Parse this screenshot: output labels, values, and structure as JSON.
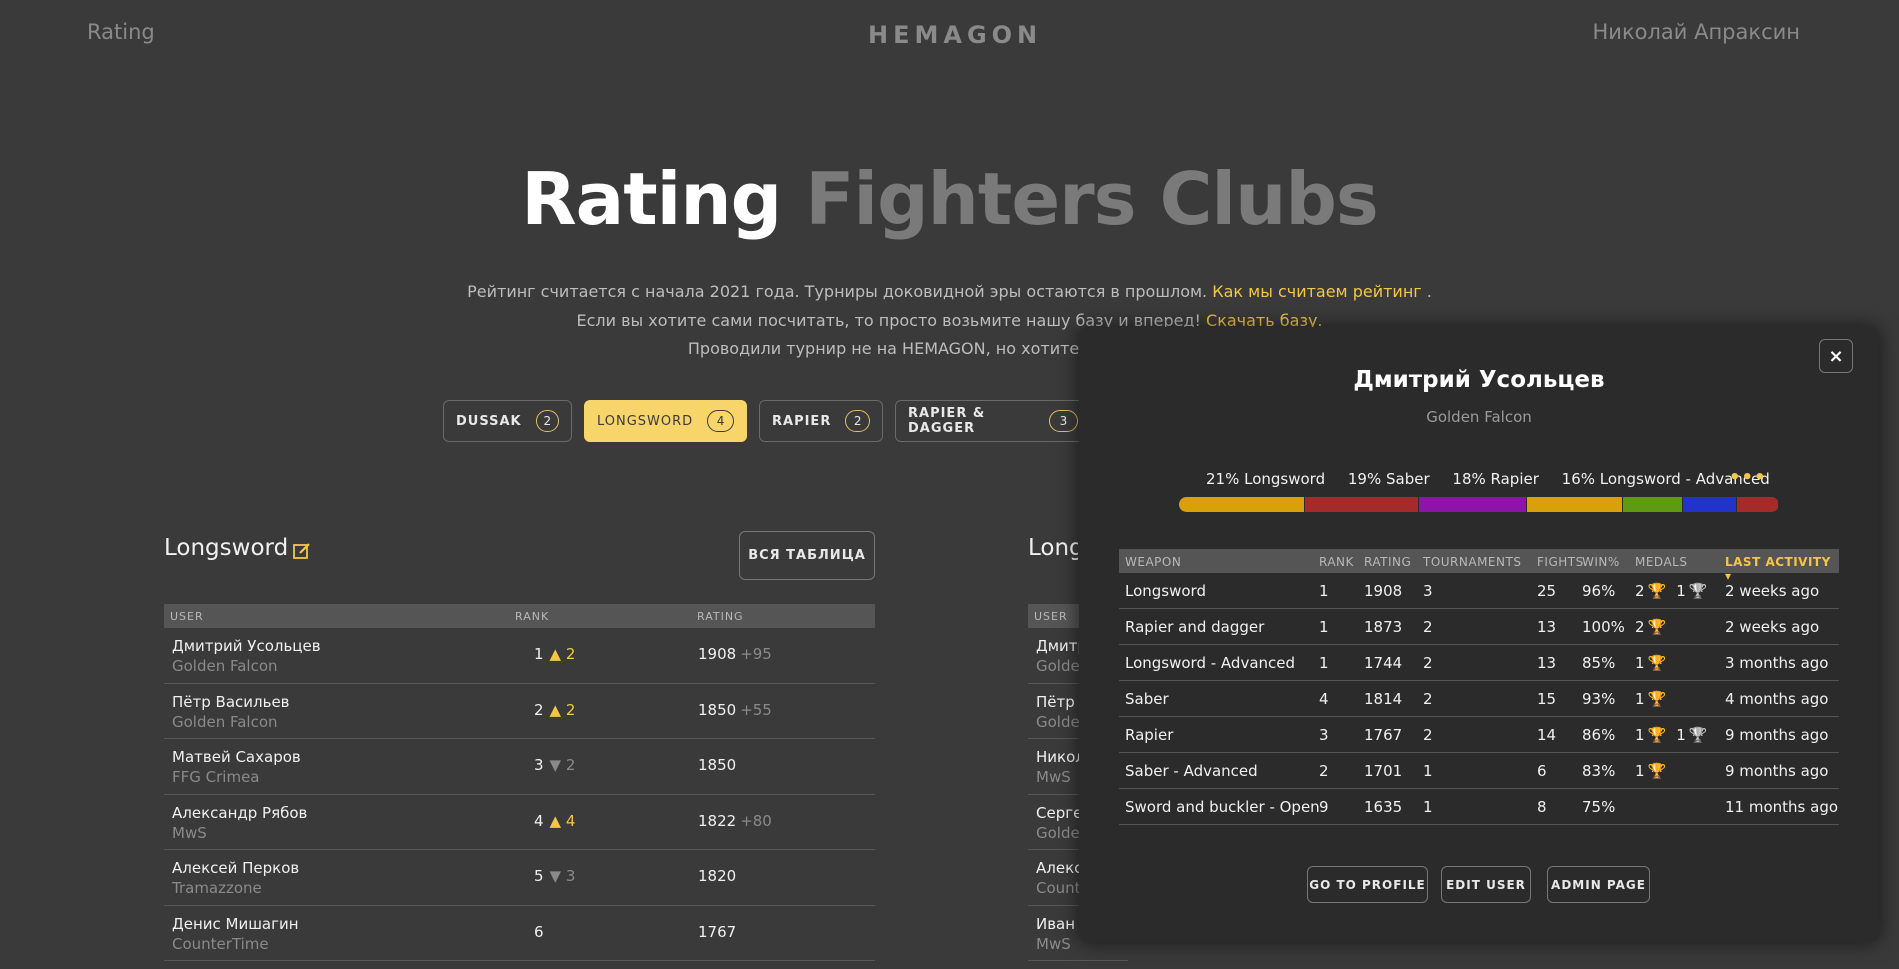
{
  "nav": {
    "rating": "Rating",
    "brand": "HEMAGON",
    "user": "Николай Апраксин"
  },
  "hero": {
    "title_white": "Rating",
    "title_gray": "Fighters Clubs"
  },
  "intro": {
    "line1": "Рейтинг считается с начала 2021 года. Турниры доковидной эры остаются в прошлом.",
    "line1_link": "Как мы считаем рейтинг",
    "line1_end": ".",
    "line2": "Если вы хотите сами посчитать, то просто возьмите нашу базу и вперед!",
    "line2_link": "Скачать базу.",
    "line3": "Проводили турнир не на HEMAGON, но хотите добавить его в"
  },
  "tabs": [
    {
      "label": "DUSSAK",
      "count": "2",
      "active": false
    },
    {
      "label": "LONGSWORD",
      "count": "4",
      "active": true
    },
    {
      "label": "RAPIER",
      "count": "2",
      "active": false
    },
    {
      "label": "RAPIER & DAGGER",
      "count": "3",
      "active": false
    }
  ],
  "left_table": {
    "title": "Longsword",
    "all_button": "ВСЯ ТАБЛИЦА",
    "headers": {
      "user": "USER",
      "rank": "RANK",
      "rating": "RATING"
    },
    "rows": [
      {
        "name": "Дмитрий Усольцев",
        "club": "Golden Falcon",
        "rank": "1",
        "arrow": "▲",
        "dir": "up",
        "change": "2",
        "rating": "1908",
        "delta": "+95"
      },
      {
        "name": "Пётр Васильев",
        "club": "Golden Falcon",
        "rank": "2",
        "arrow": "▲",
        "dir": "up",
        "change": "2",
        "rating": "1850",
        "delta": "+55"
      },
      {
        "name": "Матвей Сахаров",
        "club": "FFG Crimea",
        "rank": "3",
        "arrow": "▼",
        "dir": "dn",
        "change": "2",
        "rating": "1850",
        "delta": ""
      },
      {
        "name": "Александр Рябов",
        "club": "MwS",
        "rank": "4",
        "arrow": "▲",
        "dir": "up",
        "change": "4",
        "rating": "1822",
        "delta": "+80"
      },
      {
        "name": "Алексей Перков",
        "club": "Tramazzone",
        "rank": "5",
        "arrow": "▼",
        "dir": "dn",
        "change": "3",
        "rating": "1820",
        "delta": ""
      },
      {
        "name": "Денис Мишагин",
        "club": "CounterTime",
        "rank": "6",
        "arrow": "",
        "dir": "",
        "change": "",
        "rating": "1767",
        "delta": ""
      }
    ]
  },
  "right_table": {
    "title": "Longs",
    "headers": {
      "user": "USER"
    },
    "rows": [
      {
        "name": "Дмитр",
        "club": "Golden"
      },
      {
        "name": "Пётр В",
        "club": "Golden"
      },
      {
        "name": "Никол",
        "club": "MwS"
      },
      {
        "name": "Сергей",
        "club": "Golden"
      },
      {
        "name": "Алекса",
        "club": "Count"
      },
      {
        "name": "Иван I",
        "club": "MwS"
      }
    ]
  },
  "modal": {
    "close": "×",
    "name": "Дмитрий Усольцев",
    "club": "Golden Falcon",
    "distribution_labels": [
      "21% Longsword",
      "19% Saber",
      "18% Rapier",
      "16% Longsword - Advanced"
    ],
    "more": "•••",
    "distribution": [
      {
        "weapon": "Longsword",
        "share": 21,
        "color": "#d9a00a"
      },
      {
        "weapon": "Saber",
        "share": 19,
        "color": "#a52a2a"
      },
      {
        "weapon": "Rapier",
        "share": 18,
        "color": "#8f13a8"
      },
      {
        "weapon": "Longsword - Advanced",
        "share": 16,
        "color": "#d9a00a"
      },
      {
        "weapon": "Rapier and dagger",
        "share": 10,
        "color": "#5e9a12"
      },
      {
        "weapon": "Saber - Advanced",
        "share": 9,
        "color": "#2233cc"
      },
      {
        "weapon": "Sword and buckler - Open",
        "share": 7,
        "color": "#a52a2a"
      }
    ],
    "headers": {
      "weapon": "WEAPON",
      "rank": "RANK",
      "rating": "RATING",
      "tournaments": "TOURNAMENTS",
      "fights": "FIGHTS",
      "win": "WIN%",
      "medals": "MEDALS",
      "last": "LAST ACTIVITY"
    },
    "rows": [
      {
        "weapon": "Longsword",
        "rank": "1",
        "rating": "1908",
        "tournaments": "3",
        "fights": "25",
        "win": "96%",
        "gold": "2",
        "silver": "1",
        "last": "2 weeks ago"
      },
      {
        "weapon": "Rapier and dagger",
        "rank": "1",
        "rating": "1873",
        "tournaments": "2",
        "fights": "13",
        "win": "100%",
        "gold": "2",
        "silver": "",
        "last": "2 weeks ago"
      },
      {
        "weapon": "Longsword - Advanced",
        "rank": "1",
        "rating": "1744",
        "tournaments": "2",
        "fights": "13",
        "win": "85%",
        "gold": "1",
        "silver": "",
        "last": "3 months ago"
      },
      {
        "weapon": "Saber",
        "rank": "4",
        "rating": "1814",
        "tournaments": "2",
        "fights": "15",
        "win": "93%",
        "gold": "1",
        "silver": "",
        "last": "4 months ago"
      },
      {
        "weapon": "Rapier",
        "rank": "3",
        "rating": "1767",
        "tournaments": "2",
        "fights": "14",
        "win": "86%",
        "gold": "1",
        "silver": "1",
        "last": "9 months ago"
      },
      {
        "weapon": "Saber - Advanced",
        "rank": "2",
        "rating": "1701",
        "tournaments": "1",
        "fights": "6",
        "win": "83%",
        "gold": "1",
        "silver": "",
        "last": "9 months ago"
      },
      {
        "weapon": "Sword and buckler - Open",
        "rank": "9",
        "rating": "1635",
        "tournaments": "1",
        "fights": "8",
        "win": "75%",
        "gold": "",
        "silver": "",
        "last": "11 months ago"
      }
    ],
    "buttons": {
      "profile": "GO TO PROFILE",
      "edit": "EDIT USER",
      "admin": "ADMIN PAGE"
    }
  }
}
